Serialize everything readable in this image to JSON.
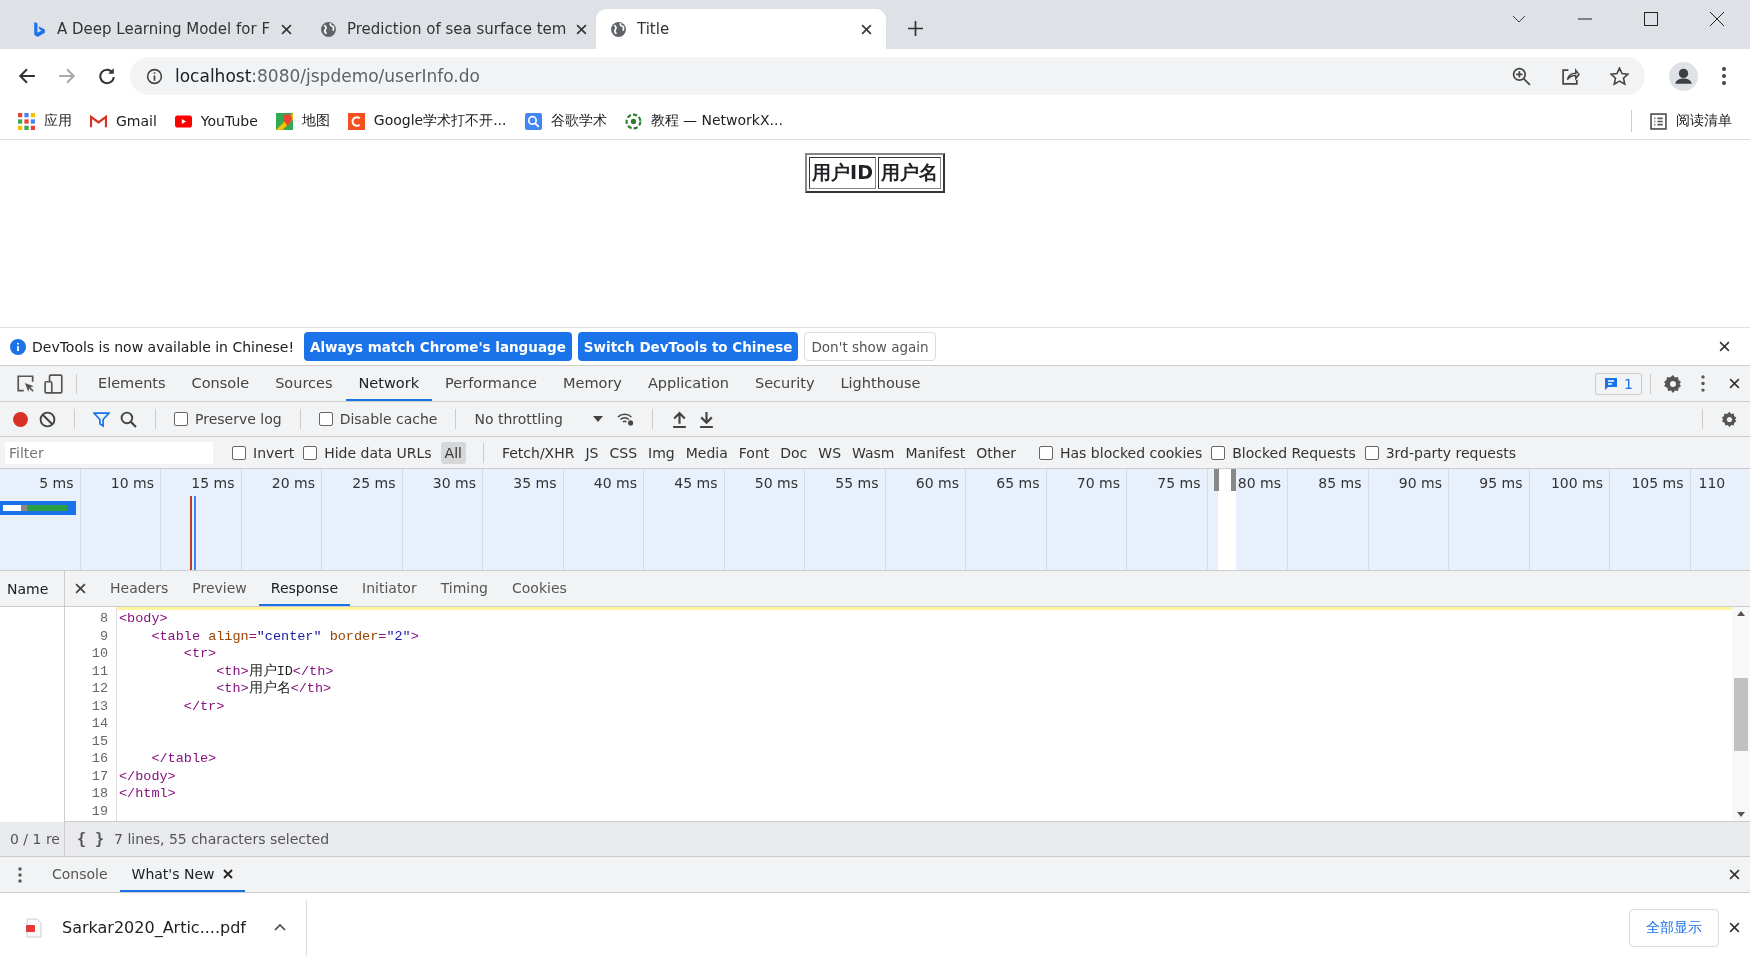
{
  "browser": {
    "tabs": [
      {
        "title": "A Deep Learning Model for F",
        "selected": false
      },
      {
        "title": "Prediction of sea surface tem",
        "selected": false
      },
      {
        "title": "Title",
        "selected": true
      }
    ],
    "url_host": "localhost",
    "url_rest": ":8080/jspdemo/userInfo.do",
    "bookmarks": [
      {
        "label": "应用"
      },
      {
        "label": "Gmail"
      },
      {
        "label": "YouTube"
      },
      {
        "label": "地图"
      },
      {
        "label": "Google学术打不开..."
      },
      {
        "label": "谷歌学术"
      },
      {
        "label": "教程 — NetworkX..."
      }
    ],
    "reading_list": "阅读清单"
  },
  "page": {
    "table_headers": [
      "用户ID",
      "用户名"
    ]
  },
  "infobar": {
    "message": "DevTools is now available in Chinese!",
    "buttons": [
      {
        "label": "Always match Chrome's language",
        "kind": "primary"
      },
      {
        "label": "Switch DevTools to Chinese",
        "kind": "primary"
      },
      {
        "label": "Don't show again",
        "kind": "secondary"
      }
    ]
  },
  "devtools": {
    "tabs": [
      {
        "label": "Elements",
        "selected": false
      },
      {
        "label": "Console",
        "selected": false
      },
      {
        "label": "Sources",
        "selected": false
      },
      {
        "label": "Network",
        "selected": true
      },
      {
        "label": "Performance",
        "selected": false
      },
      {
        "label": "Memory",
        "selected": false
      },
      {
        "label": "Application",
        "selected": false
      },
      {
        "label": "Security",
        "selected": false
      },
      {
        "label": "Lighthouse",
        "selected": false
      }
    ],
    "issues_count": "1",
    "toolbar": {
      "recording": true,
      "filter_on": true,
      "checkboxes": [
        {
          "label": "Preserve log",
          "checked": false
        },
        {
          "label": "Disable cache",
          "checked": false
        }
      ],
      "throttling": "No throttling"
    },
    "filter": {
      "placeholder": "Filter",
      "checkboxes": [
        {
          "label": "Invert",
          "checked": false
        },
        {
          "label": "Hide data URLs",
          "checked": false
        }
      ],
      "types": [
        {
          "label": "All",
          "selected": true
        },
        {
          "label": "Fetch/XHR",
          "selected": false
        },
        {
          "label": "JS",
          "selected": false
        },
        {
          "label": "CSS",
          "selected": false
        },
        {
          "label": "Img",
          "selected": false
        },
        {
          "label": "Media",
          "selected": false
        },
        {
          "label": "Font",
          "selected": false
        },
        {
          "label": "Doc",
          "selected": false
        },
        {
          "label": "WS",
          "selected": false
        },
        {
          "label": "Wasm",
          "selected": false
        },
        {
          "label": "Manifest",
          "selected": false
        },
        {
          "label": "Other",
          "selected": false
        }
      ],
      "more_checkboxes": [
        {
          "label": "Has blocked cookies",
          "checked": false
        },
        {
          "label": "Blocked Requests",
          "checked": false
        },
        {
          "label": "3rd-party requests",
          "checked": false
        }
      ]
    },
    "timeline_ticks": [
      "5 ms",
      "10 ms",
      "15 ms",
      "20 ms",
      "25 ms",
      "30 ms",
      "35 ms",
      "40 ms",
      "45 ms",
      "50 ms",
      "55 ms",
      "60 ms",
      "65 ms",
      "70 ms",
      "75 ms",
      "80 ms",
      "85 ms",
      "90 ms",
      "95 ms",
      "100 ms",
      "105 ms",
      "110"
    ],
    "name_header": "Name",
    "detail_tabs": [
      {
        "label": "Headers",
        "selected": false
      },
      {
        "label": "Preview",
        "selected": false
      },
      {
        "label": "Response",
        "selected": true
      },
      {
        "label": "Initiator",
        "selected": false
      },
      {
        "label": "Timing",
        "selected": false
      },
      {
        "label": "Cookies",
        "selected": false
      }
    ],
    "code_lines": [
      {
        "number": "8",
        "tokens": [
          {
            "kind": "tag",
            "text": "<body>"
          }
        ]
      },
      {
        "number": "9",
        "tokens": [
          {
            "kind": "tag",
            "text": "    <table "
          },
          {
            "kind": "attr",
            "text": "align"
          },
          {
            "kind": "tag",
            "text": "="
          },
          {
            "kind": "value",
            "text": "\"center\" "
          },
          {
            "kind": "attr",
            "text": "border"
          },
          {
            "kind": "tag",
            "text": "="
          },
          {
            "kind": "value",
            "text": "\"2\""
          },
          {
            "kind": "tag",
            "text": ">"
          }
        ]
      },
      {
        "number": "10",
        "tokens": [
          {
            "kind": "tag",
            "text": "        <tr>"
          }
        ]
      },
      {
        "number": "11",
        "tokens": [
          {
            "kind": "tag",
            "text": "            <th>"
          },
          {
            "kind": "plain",
            "text": "用户ID"
          },
          {
            "kind": "tag",
            "text": "</th>"
          }
        ]
      },
      {
        "number": "12",
        "tokens": [
          {
            "kind": "tag",
            "text": "            <th>"
          },
          {
            "kind": "plain",
            "text": "用户名"
          },
          {
            "kind": "tag",
            "text": "</th>"
          }
        ]
      },
      {
        "number": "13",
        "tokens": [
          {
            "kind": "tag",
            "text": "        </tr>"
          }
        ]
      },
      {
        "number": "14"
      },
      {
        "number": "15"
      },
      {
        "number": "16",
        "tokens": [
          {
            "kind": "tag",
            "text": "    </table>"
          }
        ]
      },
      {
        "number": "17",
        "tokens": [
          {
            "kind": "tag",
            "text": "</body>"
          }
        ]
      },
      {
        "number": "18",
        "tokens": [
          {
            "kind": "tag",
            "text": "</html>"
          }
        ]
      },
      {
        "number": "19"
      }
    ],
    "pretty_print_label": "{ }",
    "requests_summary": "0 / 1 re",
    "selection_status": "7 lines, 55 characters selected",
    "drawer_tabs": [
      {
        "label": "Console",
        "selected": false,
        "closable": false
      },
      {
        "label": "What's New",
        "selected": true,
        "closable": true
      }
    ]
  },
  "downloads": {
    "file": "Sarkar2020_Artic....pdf",
    "show_all": "全部显示"
  }
}
